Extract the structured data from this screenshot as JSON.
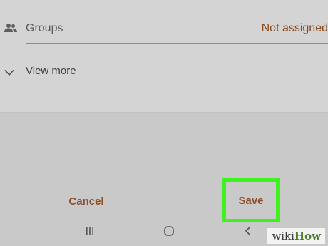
{
  "contact_form": {
    "groups": {
      "label": "Groups",
      "value": "Not assigned",
      "icon": "people-icon"
    },
    "view_more": {
      "label": "View more",
      "icon": "chevron-down-icon"
    }
  },
  "actions": {
    "cancel_label": "Cancel",
    "save_label": "Save",
    "highlight_color": "#3df21f",
    "text_color": "#8e4f2a"
  },
  "nav_bar": {
    "recents_icon": "recents-icon",
    "home_icon": "home-icon",
    "back_icon": "back-icon"
  },
  "watermark": {
    "prefix": "wiki",
    "suffix": "How"
  }
}
